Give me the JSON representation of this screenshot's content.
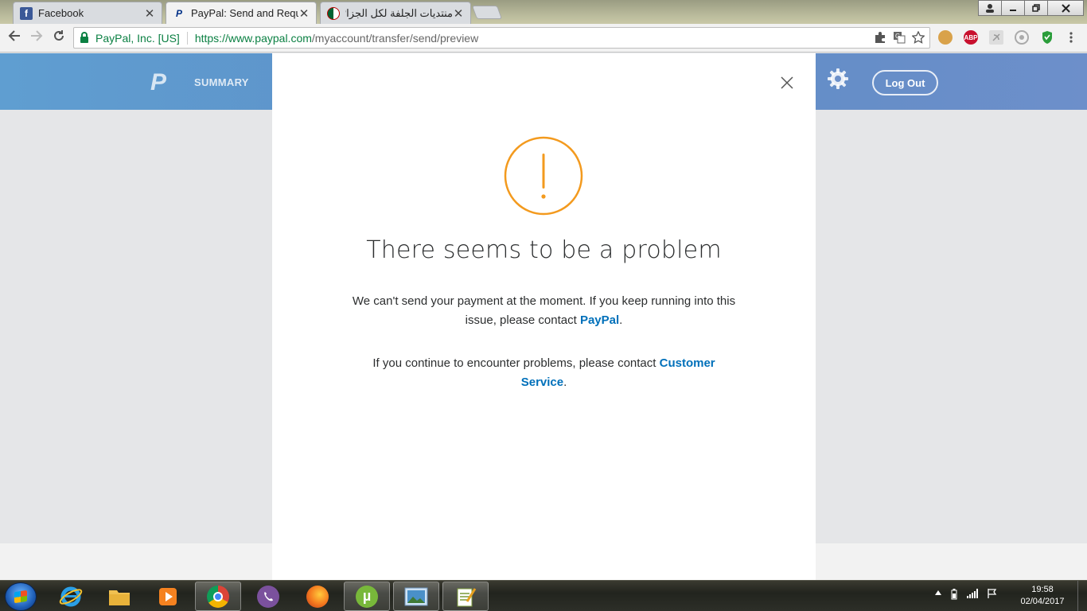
{
  "browser": {
    "tabs": [
      {
        "title": "Facebook",
        "favicon": "facebook-icon"
      },
      {
        "title": "PayPal: Send and Reques",
        "favicon": "paypal-icon"
      },
      {
        "title": "منتديات الجلفة لكل الجزائريين و",
        "favicon": "algeria-icon"
      }
    ],
    "close_glyph": "✕",
    "org_label": "PayPal, Inc. [US]",
    "url_host": "https://www.paypal.com",
    "url_path": "/myaccount/transfer/send/preview",
    "extensions": [
      "cookie-icon",
      "adblock-plus-icon",
      "acrobat-icon",
      "circle-extension-icon",
      "shield-extension-icon"
    ],
    "abp_label": "ABP"
  },
  "paypal": {
    "logo_text": "P",
    "nav_summary": "SUMMARY",
    "logout_label": "Log Out"
  },
  "modal": {
    "title": "There seems to be a problem",
    "text1_before": "We can't send your payment at the moment. If you keep running into this issue, please contact ",
    "text1_link": "PayPal",
    "text1_after": ".",
    "text2_before": "If you continue to encounter problems, please contact ",
    "text2_link": "Customer Service",
    "text2_after": ".",
    "accent_color": "#f39a1e",
    "link_color": "#0070ba"
  },
  "taskbar": {
    "items": [
      "internet-explorer-icon",
      "file-explorer-icon",
      "media-player-icon",
      "chrome-icon",
      "viber-icon",
      "firefox-icon",
      "utorrent-icon",
      "photo-viewer-icon",
      "notepad-plus-plus-icon"
    ],
    "time": "19:58",
    "date": "02/04/2017"
  }
}
